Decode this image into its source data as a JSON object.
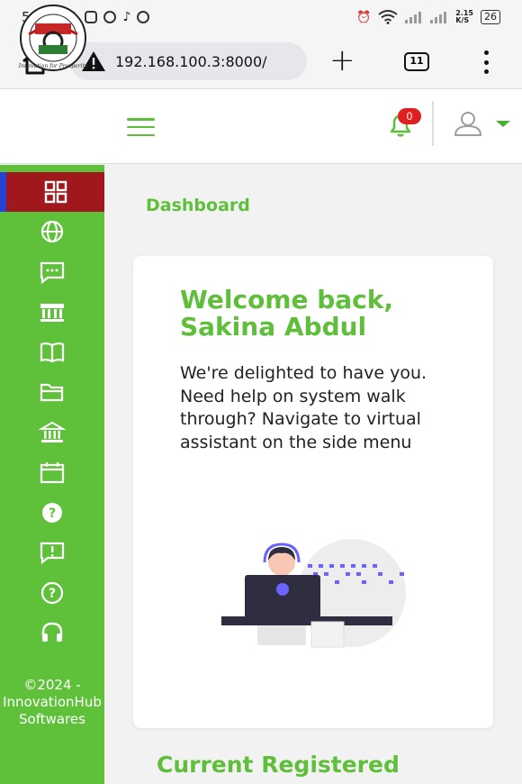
{
  "status_bar": {
    "time": "5:08 PM",
    "net_speed_value": "2.15",
    "net_speed_unit": "K/S",
    "battery": "26"
  },
  "browser": {
    "url": "192.168.100.3:8000/",
    "tab_count": "11"
  },
  "header": {
    "logo_icon": "university-logo",
    "notification_count": "0"
  },
  "sidebar": {
    "items": [
      {
        "icon": "dashboard-icon",
        "active": true
      },
      {
        "icon": "globe-icon"
      },
      {
        "icon": "chat-icon"
      },
      {
        "icon": "building-icon"
      },
      {
        "icon": "book-icon"
      },
      {
        "icon": "folder-icon"
      },
      {
        "icon": "bank-icon"
      },
      {
        "icon": "calendar-icon"
      },
      {
        "icon": "help-filled-icon"
      },
      {
        "icon": "feedback-icon"
      },
      {
        "icon": "help-outline-icon"
      },
      {
        "icon": "headset-icon"
      }
    ],
    "footer": [
      "©2024 -",
      "InnovationHub",
      "Softwares"
    ]
  },
  "main": {
    "page_title": "Dashboard",
    "welcome_title": "Welcome back, Sakina Abdul",
    "welcome_message": "We're delighted to have you. Need help on system walk through? Navigate to virtual assistant on the side menu",
    "section_title": "Current Registered"
  },
  "colors": {
    "brand_green": "#5fc13a",
    "active_red": "#a1181c",
    "active_indicator": "#2544d6",
    "badge_red": "#e02020"
  }
}
